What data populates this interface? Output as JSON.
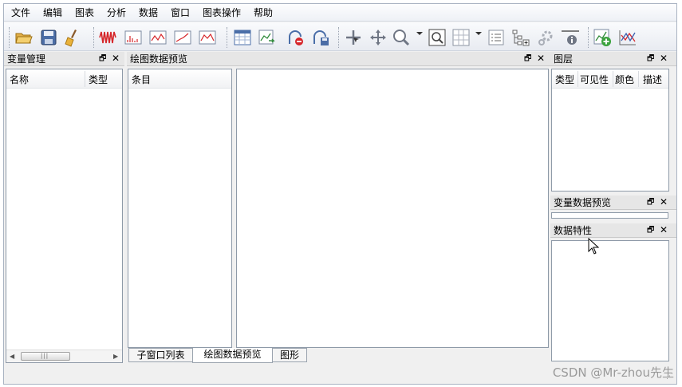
{
  "menubar": {
    "items": [
      "文件",
      "编辑",
      "图表",
      "分析",
      "数据",
      "窗口",
      "图表操作",
      "帮助"
    ]
  },
  "toolbar": {
    "buttons": [
      "open-folder-icon",
      "save-icon",
      "clear-icon",
      "signal-icon",
      "bar-chart-icon",
      "line-chart-icon",
      "trend-chart-icon",
      "area-chart-icon",
      "table-icon",
      "export-chart-icon",
      "remove-icon",
      "save-chart-icon",
      "select-pointer-icon",
      "pan-icon",
      "zoom-icon",
      "zoom-region-icon",
      "grid-icon",
      "legend-list-icon",
      "tree-add-icon",
      "settings-icon",
      "info-icon",
      "add-layer-icon",
      "curve-fit-icon"
    ]
  },
  "variable_manager": {
    "title": "变量管理",
    "columns": [
      "名称",
      "类型"
    ]
  },
  "plot_preview": {
    "title": "绘图数据预览",
    "list_header": "条目"
  },
  "bottom_tabs": [
    "子窗口列表",
    "绘图数据预览",
    "图形"
  ],
  "active_tab": "绘图数据预览",
  "layers": {
    "title": "图层",
    "columns": [
      "类型",
      "可见性",
      "颜色",
      "描述"
    ]
  },
  "variable_preview": {
    "title": "变量数据预览"
  },
  "data_properties": {
    "title": "数据特性"
  },
  "dock_buttons": {
    "float": "🗗",
    "close": "✕"
  },
  "watermark": "CSDN @Mr-zhou先生"
}
